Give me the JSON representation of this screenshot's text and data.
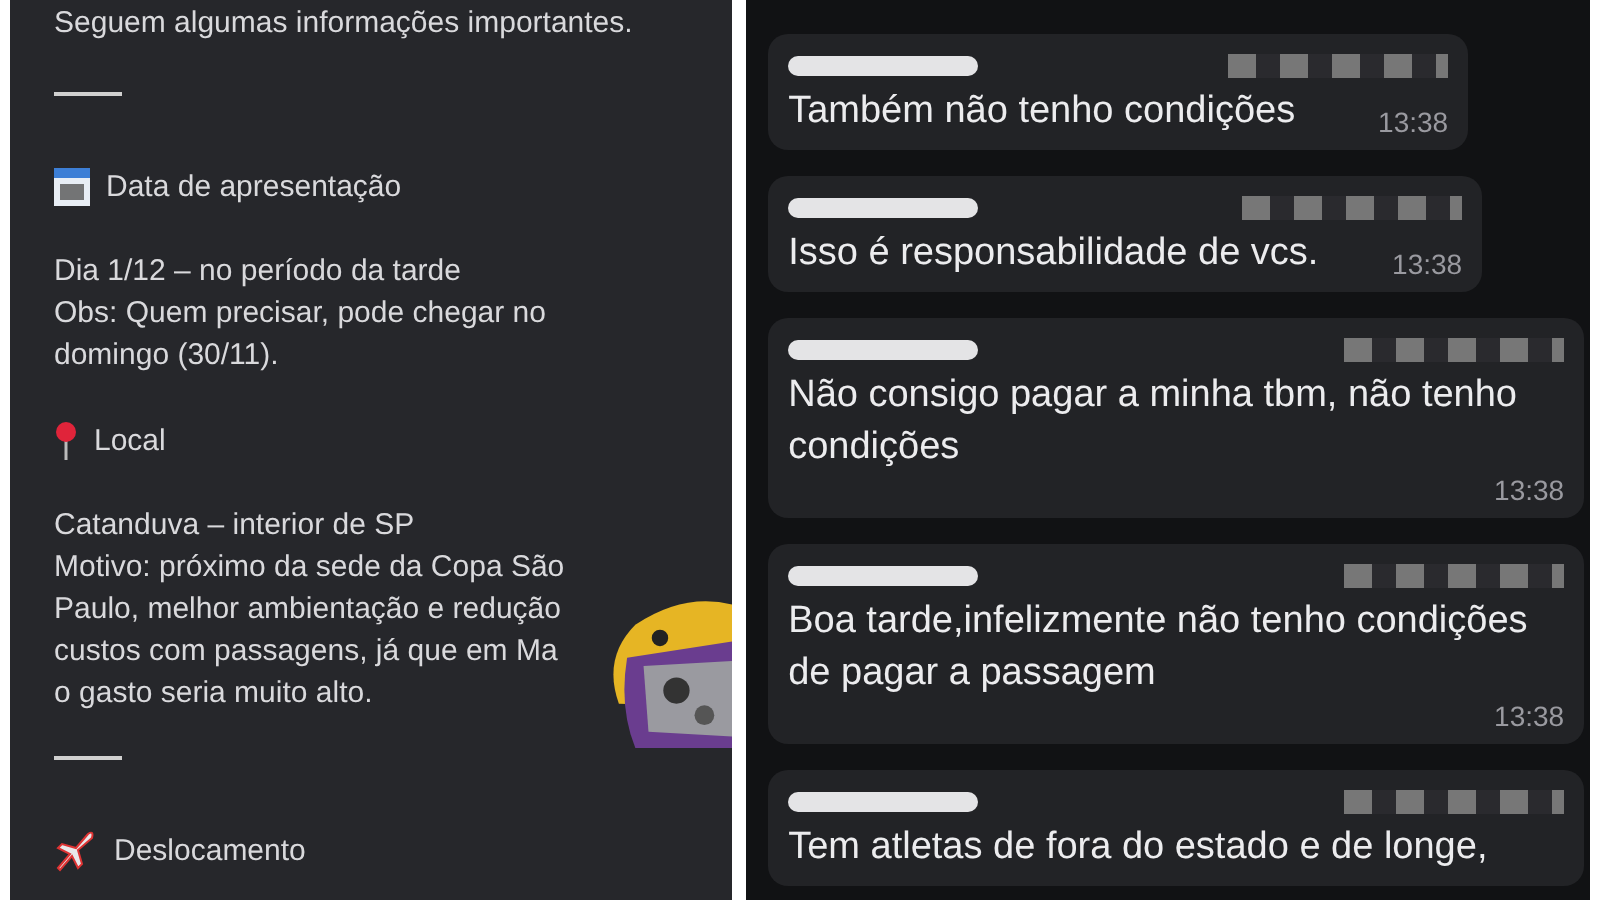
{
  "announcement": {
    "items": [
      {
        "kind": "text",
        "lines": [
          "Seguem algumas informações importantes."
        ]
      },
      {
        "kind": "divider"
      },
      {
        "kind": "heading",
        "text": "Data de apresentação"
      },
      {
        "kind": "text",
        "lines": [
          "Dia 1/12 – no período da tarde",
          "Obs: Quem precisar, pode chegar no",
          "domingo (30/11)."
        ]
      },
      {
        "kind": "heading",
        "text": "Local"
      },
      {
        "kind": "text",
        "lines": [
          "Catanduva – interior de SP",
          "Motivo: próximo da sede da Copa São",
          "Paulo, melhor ambientação e redução",
          "custos com passagens, já que em Ma",
          "o gasto seria muito alto."
        ]
      },
      {
        "kind": "divider"
      },
      {
        "kind": "heading",
        "text": "Deslocamento"
      }
    ]
  },
  "chat": {
    "messages": [
      {
        "lines": [
          "Também não tenho condições"
        ],
        "time": "13:38"
      },
      {
        "lines": [
          "Isso é responsabilidade de vcs."
        ],
        "time": "13:38"
      },
      {
        "lines": [
          "Não consigo pagar a minha tbm, não tenho",
          "condições"
        ],
        "time": "13:38"
      },
      {
        "lines": [
          "Boa tarde,infelizmente não tenho condições",
          "de pagar a passagem"
        ],
        "time": "13:38"
      },
      {
        "lines": [
          "Tem atletas de fora do estado e de longe,"
        ]
      }
    ]
  }
}
